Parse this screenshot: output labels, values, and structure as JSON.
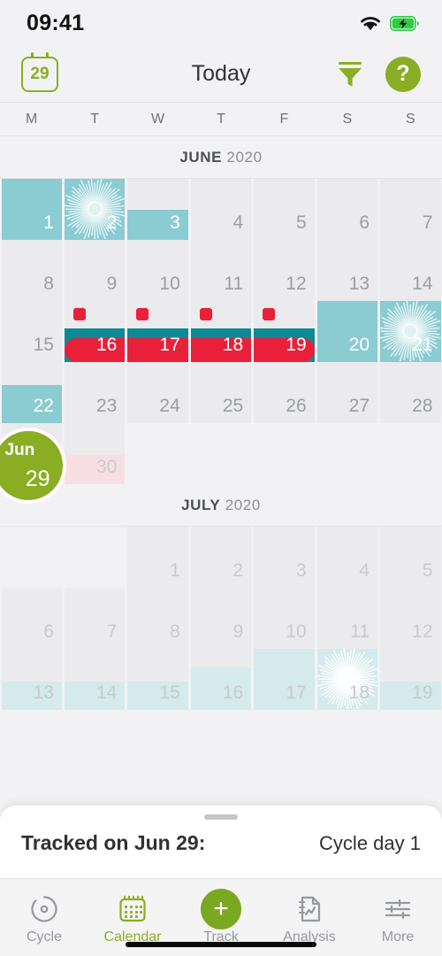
{
  "status_bar": {
    "time": "09:41",
    "wifi_icon": "wifi-icon",
    "battery_icon": "battery-charging-icon"
  },
  "nav": {
    "today_badge_day": "29",
    "title": "Today",
    "filter_icon": "filter-icon",
    "help_label": "?"
  },
  "weekdays": [
    "M",
    "T",
    "W",
    "T",
    "F",
    "S",
    "S"
  ],
  "months": [
    {
      "name": "JUNE",
      "year": "2020",
      "weeks": [
        [
          {
            "day": "1",
            "style": "fertile-full",
            "num": "light"
          },
          {
            "day": "2",
            "style": "ovulation",
            "num": "light"
          },
          {
            "day": "3",
            "style": "fertile-half",
            "num": "light"
          },
          {
            "day": "4",
            "style": "plain",
            "num": "normal"
          },
          {
            "day": "5",
            "style": "plain",
            "num": "normal"
          },
          {
            "day": "6",
            "style": "plain",
            "num": "normal"
          },
          {
            "day": "7",
            "style": "plain",
            "num": "normal"
          }
        ],
        [
          {
            "day": "8",
            "style": "plain",
            "num": "normal"
          },
          {
            "day": "9",
            "style": "plain",
            "num": "normal"
          },
          {
            "day": "10",
            "style": "plain",
            "num": "normal"
          },
          {
            "day": "11",
            "style": "plain",
            "num": "normal"
          },
          {
            "day": "12",
            "style": "plain",
            "num": "normal"
          },
          {
            "day": "13",
            "style": "plain",
            "num": "normal"
          },
          {
            "day": "14",
            "style": "plain",
            "num": "normal"
          }
        ],
        [
          {
            "day": "15",
            "style": "plain",
            "num": "normal"
          },
          {
            "day": "16",
            "style": "period-start",
            "num": "light"
          },
          {
            "day": "17",
            "style": "period-mid",
            "num": "light"
          },
          {
            "day": "18",
            "style": "period-mid",
            "num": "light"
          },
          {
            "day": "19",
            "style": "period-end",
            "num": "light"
          },
          {
            "day": "20",
            "style": "fertile-full",
            "num": "light"
          },
          {
            "day": "21",
            "style": "ovulation",
            "num": "light"
          }
        ],
        [
          {
            "day": "22",
            "style": "fertile-part",
            "num": "light"
          },
          {
            "day": "23",
            "style": "plain",
            "num": "normal"
          },
          {
            "day": "24",
            "style": "plain",
            "num": "normal"
          },
          {
            "day": "25",
            "style": "plain",
            "num": "normal"
          },
          {
            "day": "26",
            "style": "plain",
            "num": "normal"
          },
          {
            "day": "27",
            "style": "plain",
            "num": "normal"
          },
          {
            "day": "28",
            "style": "plain",
            "num": "normal"
          }
        ],
        [
          {
            "day": "29",
            "style": "today",
            "num": "hidden"
          },
          {
            "day": "30",
            "style": "pink-part",
            "num": "dim"
          },
          {
            "day": "",
            "style": "blank",
            "num": "hidden"
          },
          {
            "day": "",
            "style": "blank",
            "num": "hidden"
          },
          {
            "day": "",
            "style": "blank",
            "num": "hidden"
          },
          {
            "day": "",
            "style": "blank",
            "num": "hidden"
          },
          {
            "day": "",
            "style": "blank",
            "num": "hidden"
          }
        ]
      ]
    },
    {
      "name": "JULY",
      "year": "2020",
      "weeks": [
        [
          {
            "day": "",
            "style": "blank",
            "num": "hidden"
          },
          {
            "day": "",
            "style": "blank",
            "num": "hidden"
          },
          {
            "day": "1",
            "style": "plain",
            "num": "dim"
          },
          {
            "day": "2",
            "style": "plain",
            "num": "dim"
          },
          {
            "day": "3",
            "style": "plain",
            "num": "dim"
          },
          {
            "day": "4",
            "style": "plain",
            "num": "dim"
          },
          {
            "day": "5",
            "style": "plain",
            "num": "dim"
          }
        ],
        [
          {
            "day": "6",
            "style": "plain",
            "num": "dim"
          },
          {
            "day": "7",
            "style": "plain",
            "num": "dim"
          },
          {
            "day": "8",
            "style": "plain",
            "num": "dim"
          },
          {
            "day": "9",
            "style": "plain",
            "num": "dim"
          },
          {
            "day": "10",
            "style": "plain",
            "num": "dim"
          },
          {
            "day": "11",
            "style": "plain",
            "num": "dim"
          },
          {
            "day": "12",
            "style": "plain",
            "num": "dim"
          }
        ],
        [
          {
            "day": "13",
            "style": "pale-small",
            "num": "dim"
          },
          {
            "day": "14",
            "style": "pale-small",
            "num": "dim"
          },
          {
            "day": "15",
            "style": "pale-small",
            "num": "dim"
          },
          {
            "day": "16",
            "style": "pale-mid",
            "num": "dim"
          },
          {
            "day": "17",
            "style": "pale-full",
            "num": "dim"
          },
          {
            "day": "18",
            "style": "pale-ovul",
            "num": "dim"
          },
          {
            "day": "19",
            "style": "pale-small",
            "num": "dim"
          }
        ],
        [
          {
            "day": "",
            "style": "blank",
            "num": "hidden"
          },
          {
            "day": "",
            "style": "blank",
            "num": "hidden"
          },
          {
            "day": "",
            "style": "blank",
            "num": "hidden"
          },
          {
            "day": "",
            "style": "blank",
            "num": "hidden"
          },
          {
            "day": "",
            "style": "blank",
            "num": "hidden"
          },
          {
            "day": "",
            "style": "blank",
            "num": "hidden"
          },
          {
            "day": "",
            "style": "blank",
            "num": "hidden"
          }
        ]
      ]
    }
  ],
  "today_bubble": {
    "month": "Jun",
    "day": "29"
  },
  "sheet": {
    "tracked_label": "Tracked on Jun 29:",
    "cycle_day": "Cycle day 1"
  },
  "tabs": [
    {
      "label": "Cycle",
      "icon": "cycle-icon",
      "active": false
    },
    {
      "label": "Calendar",
      "icon": "calendar-icon",
      "active": true
    },
    {
      "label": "Track",
      "icon": "plus-icon",
      "active": false
    },
    {
      "label": "Analysis",
      "icon": "analysis-icon",
      "active": false
    },
    {
      "label": "More",
      "icon": "sliders-icon",
      "active": false
    }
  ],
  "colors": {
    "accent_green": "#8aad24",
    "fertile_teal": "#8bcbd2",
    "period_red": "#e8203a",
    "period_band": "#0d8a96",
    "pale_teal": "#d4eaec",
    "pink": "#f8dfe4"
  }
}
